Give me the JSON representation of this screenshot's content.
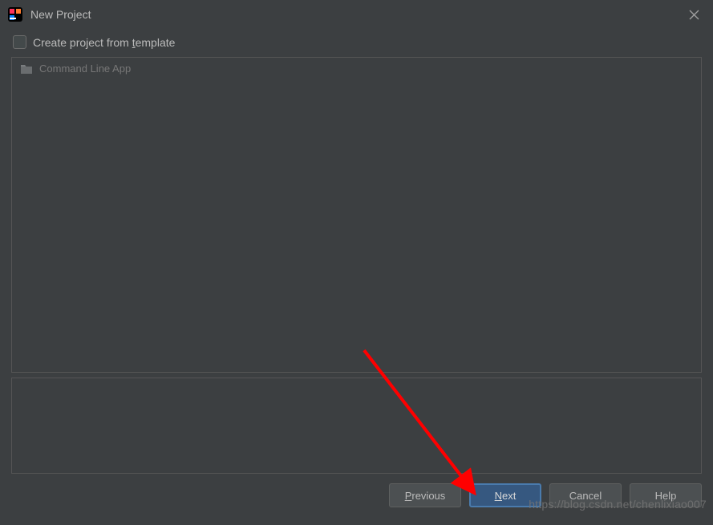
{
  "titlebar": {
    "title": "New Project"
  },
  "checkbox": {
    "label_pre": "Create project from ",
    "label_underlined": "t",
    "label_post": "emplate"
  },
  "templates": {
    "items": [
      {
        "label": "Command Line App"
      }
    ]
  },
  "buttons": {
    "previous_u": "P",
    "previous_rest": "revious",
    "next_u": "N",
    "next_rest": "ext",
    "cancel": "Cancel",
    "help": "Help"
  },
  "watermark": "https://blog.csdn.net/chenlixiao007"
}
